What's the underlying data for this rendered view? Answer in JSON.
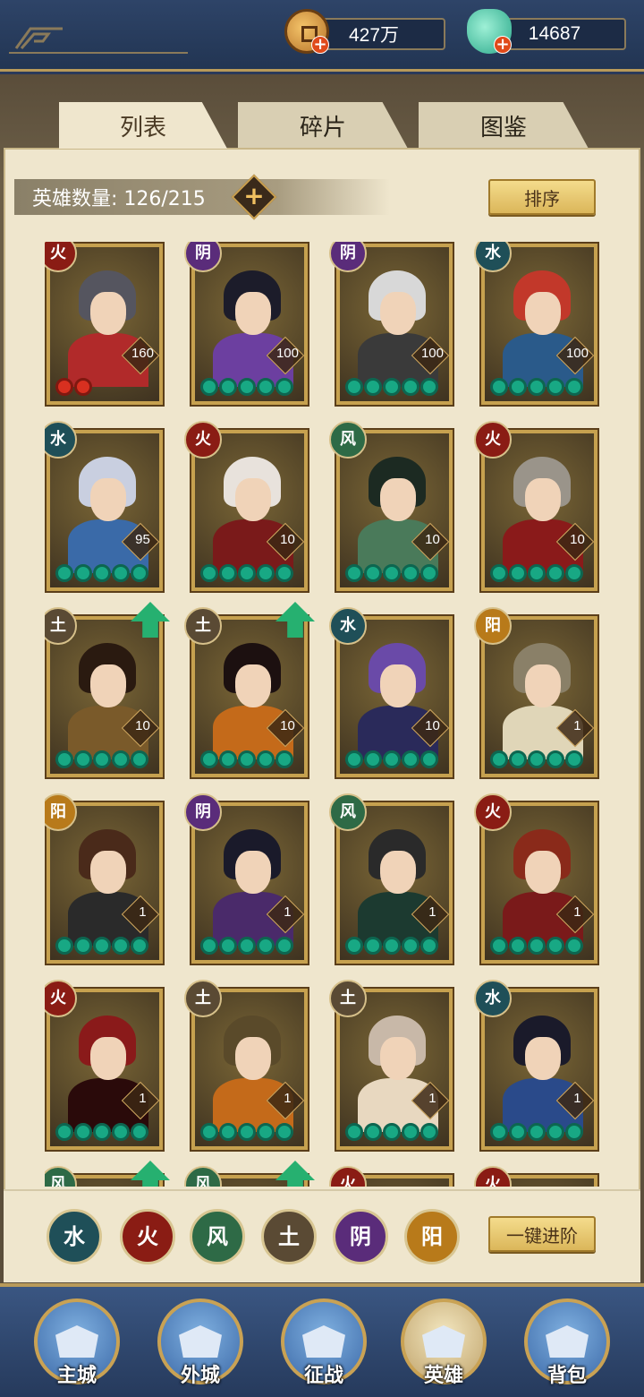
{
  "currency": {
    "coins": "427万",
    "jade": "14687"
  },
  "tabs": [
    "列表",
    "碎片",
    "图鉴"
  ],
  "hero_count_label": "英雄数量: 126/215",
  "sort_button": "排序",
  "promote_all_button": "一键进阶",
  "element_filters": [
    {
      "glyph": "水",
      "color": "#1f4f58"
    },
    {
      "glyph": "火",
      "color": "#8a1c14"
    },
    {
      "glyph": "风",
      "color": "#2e6a46"
    },
    {
      "glyph": "土",
      "color": "#5a4a34"
    },
    {
      "glyph": "阴",
      "color": "#5a2c7a"
    },
    {
      "glyph": "阳",
      "color": "#b87a1a"
    }
  ],
  "heroes": [
    {
      "element": "火",
      "level": "160",
      "stars": 2,
      "star_color": "red",
      "hair": "#55555f",
      "body": "#b12a2a",
      "upgradable": false
    },
    {
      "element": "阴",
      "level": "100",
      "stars": 5,
      "star_color": "green",
      "hair": "#1c1c2a",
      "body": "#6c3fa0",
      "upgradable": false
    },
    {
      "element": "阴",
      "level": "100",
      "stars": 5,
      "star_color": "green",
      "hair": "#d8d8d8",
      "body": "#3a3a3a",
      "upgradable": false
    },
    {
      "element": "水",
      "level": "100",
      "stars": 5,
      "star_color": "green",
      "hair": "#c2382a",
      "body": "#2a5a8a",
      "upgradable": false
    },
    {
      "element": "水",
      "level": "95",
      "stars": 5,
      "star_color": "green",
      "hair": "#c9cfe0",
      "body": "#3a6aa8",
      "upgradable": false
    },
    {
      "element": "火",
      "level": "10",
      "stars": 5,
      "star_color": "green",
      "hair": "#e8e2dc",
      "body": "#7a1a1a",
      "upgradable": false
    },
    {
      "element": "风",
      "level": "10",
      "stars": 5,
      "star_color": "green",
      "hair": "#1c2a22",
      "body": "#4a7a5a",
      "upgradable": false
    },
    {
      "element": "火",
      "level": "10",
      "stars": 5,
      "star_color": "green",
      "hair": "#9a948a",
      "body": "#8a1a1a",
      "upgradable": false
    },
    {
      "element": "土",
      "level": "10",
      "stars": 5,
      "star_color": "green",
      "hair": "#2a1a10",
      "body": "#7a5a2a",
      "upgradable": true
    },
    {
      "element": "土",
      "level": "10",
      "stars": 5,
      "star_color": "green",
      "hair": "#1c1010",
      "body": "#c46a1a",
      "upgradable": true
    },
    {
      "element": "水",
      "level": "10",
      "stars": 5,
      "star_color": "green",
      "hair": "#6a4aa8",
      "body": "#2a2a5a",
      "upgradable": false
    },
    {
      "element": "阳",
      "level": "1",
      "stars": 5,
      "star_color": "green",
      "hair": "#8a8068",
      "body": "#e0d6b8",
      "upgradable": false
    },
    {
      "element": "阳",
      "level": "1",
      "stars": 5,
      "star_color": "green",
      "hair": "#4a2a1a",
      "body": "#2a2a2a",
      "upgradable": false
    },
    {
      "element": "阴",
      "level": "1",
      "stars": 5,
      "star_color": "green",
      "hair": "#1a1a2a",
      "body": "#4a2a6a",
      "upgradable": false
    },
    {
      "element": "风",
      "level": "1",
      "stars": 5,
      "star_color": "green",
      "hair": "#2a2a2a",
      "body": "#1c3a30",
      "upgradable": false
    },
    {
      "element": "火",
      "level": "1",
      "stars": 5,
      "star_color": "green",
      "hair": "#8a2a1a",
      "body": "#7a1a1a",
      "upgradable": false
    },
    {
      "element": "火",
      "level": "1",
      "stars": 5,
      "star_color": "green",
      "hair": "#8a1a1a",
      "body": "#2a0a0a",
      "upgradable": false
    },
    {
      "element": "土",
      "level": "1",
      "stars": 5,
      "star_color": "green",
      "hair": "#5a4a2a",
      "body": "#c46a1a",
      "upgradable": false
    },
    {
      "element": "土",
      "level": "1",
      "stars": 5,
      "star_color": "green",
      "hair": "#c8b8a8",
      "body": "#e8d8c0",
      "upgradable": false
    },
    {
      "element": "水",
      "level": "1",
      "stars": 5,
      "star_color": "green",
      "hair": "#1a1a2a",
      "body": "#2a4a8a",
      "upgradable": false
    },
    {
      "element": "风",
      "level": "",
      "stars": 0,
      "star_color": "green",
      "hair": "#3a3a3a",
      "body": "#3a3a3a",
      "upgradable": true
    },
    {
      "element": "风",
      "level": "",
      "stars": 0,
      "star_color": "green",
      "hair": "#3a3a3a",
      "body": "#3a3a3a",
      "upgradable": true
    },
    {
      "element": "火",
      "level": "",
      "stars": 0,
      "star_color": "green",
      "hair": "#3a3a3a",
      "body": "#3a3a3a",
      "upgradable": false
    },
    {
      "element": "火",
      "level": "",
      "stars": 0,
      "star_color": "green",
      "hair": "#3a3a3a",
      "body": "#3a3a3a",
      "upgradable": false
    }
  ],
  "element_colors": {
    "火": "#8a1c14",
    "阴": "#5a2c7a",
    "水": "#1f4f58",
    "风": "#2e6a46",
    "土": "#5a4a34",
    "阳": "#b87a1a"
  },
  "nav": [
    {
      "label": "主城",
      "active": false
    },
    {
      "label": "外城",
      "active": false
    },
    {
      "label": "征战",
      "active": false
    },
    {
      "label": "英雄",
      "active": true
    },
    {
      "label": "背包",
      "active": false
    }
  ]
}
